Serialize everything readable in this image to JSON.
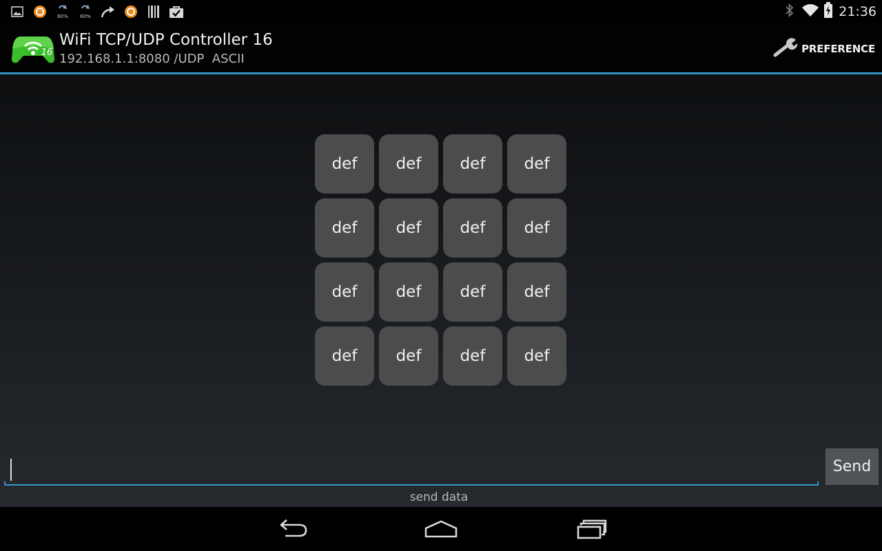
{
  "status_bar": {
    "left_icons": [
      "image-icon",
      "orange-ring-icon",
      "sync-60-icon",
      "sync-60-icon",
      "share-arrow-icon",
      "orange-ring-icon",
      "barcode-icon",
      "store-bag-icon"
    ],
    "percent_badge": "60%",
    "time": "21:36"
  },
  "action_bar": {
    "title": "WiFi TCP/UDP Controller 16",
    "subtitle": "192.168.1.1:8080 /UDP  ASCII",
    "logo_badge": "16",
    "preference_label": "PREFERENCE"
  },
  "pad": {
    "buttons": [
      "def",
      "def",
      "def",
      "def",
      "def",
      "def",
      "def",
      "def",
      "def",
      "def",
      "def",
      "def",
      "def",
      "def",
      "def",
      "def"
    ]
  },
  "send_form": {
    "input_value": "",
    "send_label": "Send",
    "hint": "send data"
  },
  "colors": {
    "accent": "#3596c7",
    "button": "#4c4c4c",
    "logo_green": "#3cbd2c"
  }
}
